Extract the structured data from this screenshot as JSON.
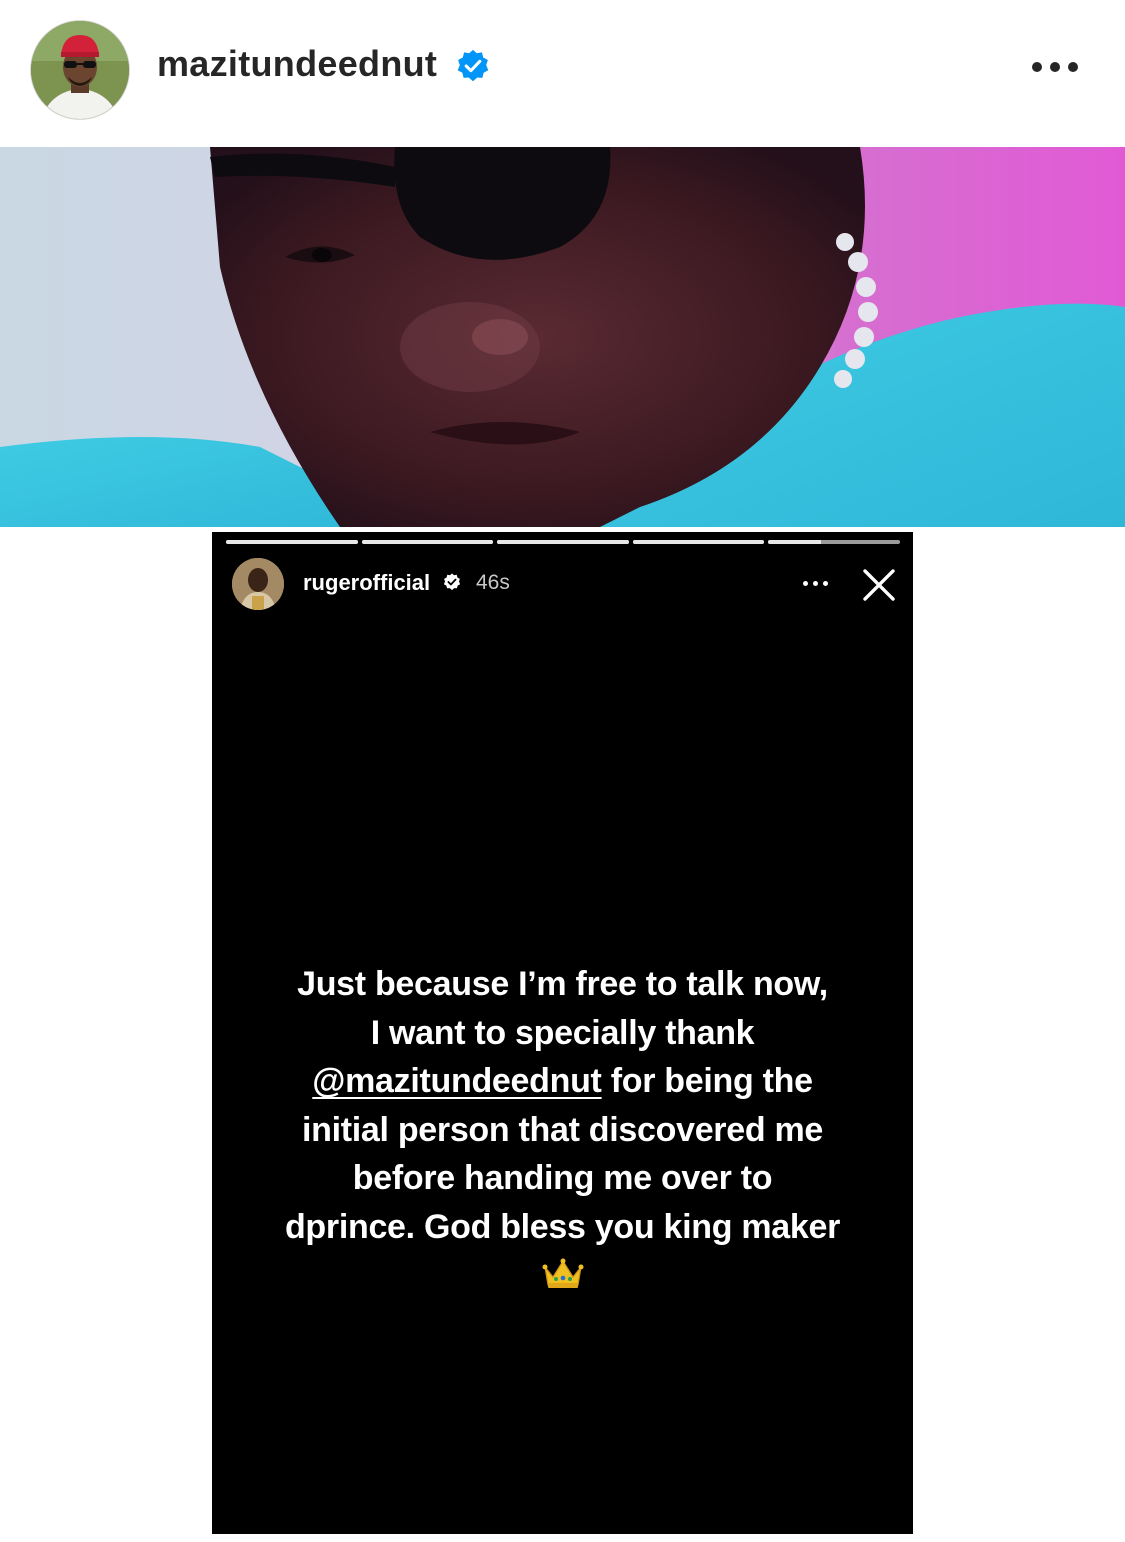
{
  "post": {
    "username": "mazitundeednut",
    "verified": true,
    "avatar_icon": "profile-photo",
    "more_icon": "more-horizontal-icon"
  },
  "story": {
    "username": "rugerofficial",
    "verified": true,
    "time": "46s",
    "segments": 5,
    "current_segment_progress": 0.4,
    "caption": {
      "line1": "Just because I’m free to talk now,",
      "line2": "I want to specially thank",
      "mention": "@mazitundeednut",
      "line3_rest": " for being the",
      "line4": "initial person that discovered me",
      "line5": "before handing me over to",
      "line6": "dprince. God bless you king maker"
    },
    "emoji": "crown-emoji",
    "more_icon": "more-horizontal-icon",
    "close_icon": "close-icon"
  },
  "colors": {
    "verified_blue": "#0095f6",
    "text_dark": "#262626",
    "story_bg": "#000000"
  }
}
